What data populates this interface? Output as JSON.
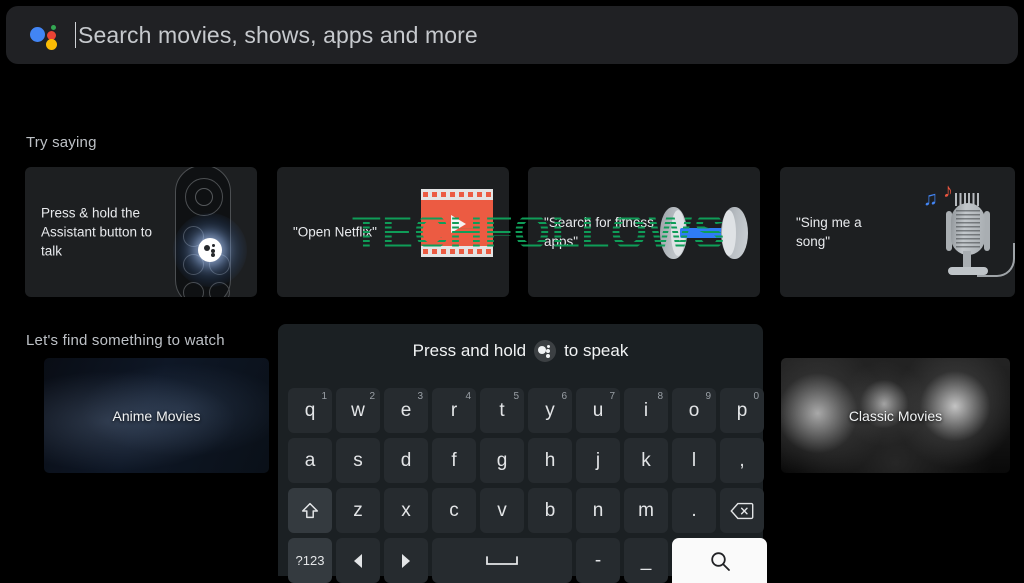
{
  "search": {
    "placeholder": "Search movies, shows, apps and more",
    "assistant_icon": "google-assistant-icon",
    "colors": {
      "blue": "#4285f4",
      "green": "#34a853",
      "red": "#ea4335",
      "yellow": "#fbbc05"
    }
  },
  "try_saying": {
    "title": "Try saying",
    "cards": [
      {
        "text": "Press & hold the Assistant button to talk",
        "art": "tv-remote-illustration"
      },
      {
        "text": "\"Open Netflix\"",
        "art": "film-strip-play-icon"
      },
      {
        "text": "\"Search for fitness apps\"",
        "art": "dumbbell-icon"
      },
      {
        "text": "\"Sing me a song\"",
        "art": "microphone-music-notes-icon"
      }
    ]
  },
  "watch": {
    "title": "Let's find something to watch",
    "cards": [
      {
        "label": "Anime Movies"
      },
      {
        "label": "Classic Movies"
      }
    ]
  },
  "keyboard": {
    "hint_prefix": "Press and hold",
    "hint_suffix": "to speak",
    "hint_icon": "assistant-badge-icon",
    "rows": [
      [
        {
          "label": "q",
          "sup": "1"
        },
        {
          "label": "w",
          "sup": "2"
        },
        {
          "label": "e",
          "sup": "3"
        },
        {
          "label": "r",
          "sup": "4"
        },
        {
          "label": "t",
          "sup": "5"
        },
        {
          "label": "y",
          "sup": "6"
        },
        {
          "label": "u",
          "sup": "7"
        },
        {
          "label": "i",
          "sup": "8"
        },
        {
          "label": "o",
          "sup": "9"
        },
        {
          "label": "p",
          "sup": "0"
        }
      ],
      [
        {
          "label": "a"
        },
        {
          "label": "s"
        },
        {
          "label": "d"
        },
        {
          "label": "f"
        },
        {
          "label": "g"
        },
        {
          "label": "h"
        },
        {
          "label": "j"
        },
        {
          "label": "k"
        },
        {
          "label": "l"
        },
        {
          "label": ","
        }
      ],
      [
        {
          "label": "",
          "icon": "shift-icon",
          "mod": true
        },
        {
          "label": "z"
        },
        {
          "label": "x"
        },
        {
          "label": "c"
        },
        {
          "label": "v"
        },
        {
          "label": "b"
        },
        {
          "label": "n"
        },
        {
          "label": "m"
        },
        {
          "label": "."
        },
        {
          "label": "",
          "icon": "backspace-icon"
        }
      ],
      [
        {
          "label": "?123",
          "mod": true
        },
        {
          "label": "",
          "icon": "arrow-left-icon"
        },
        {
          "label": "",
          "icon": "arrow-right-icon"
        },
        {
          "label": "",
          "icon": "space-icon",
          "wide": true
        },
        {
          "label": "-"
        },
        {
          "label": "_"
        },
        {
          "label": "",
          "icon": "search-icon",
          "search": true
        }
      ]
    ]
  },
  "watermark": {
    "text": "TECHFOLLOWS",
    "color": "#0f9d58"
  }
}
